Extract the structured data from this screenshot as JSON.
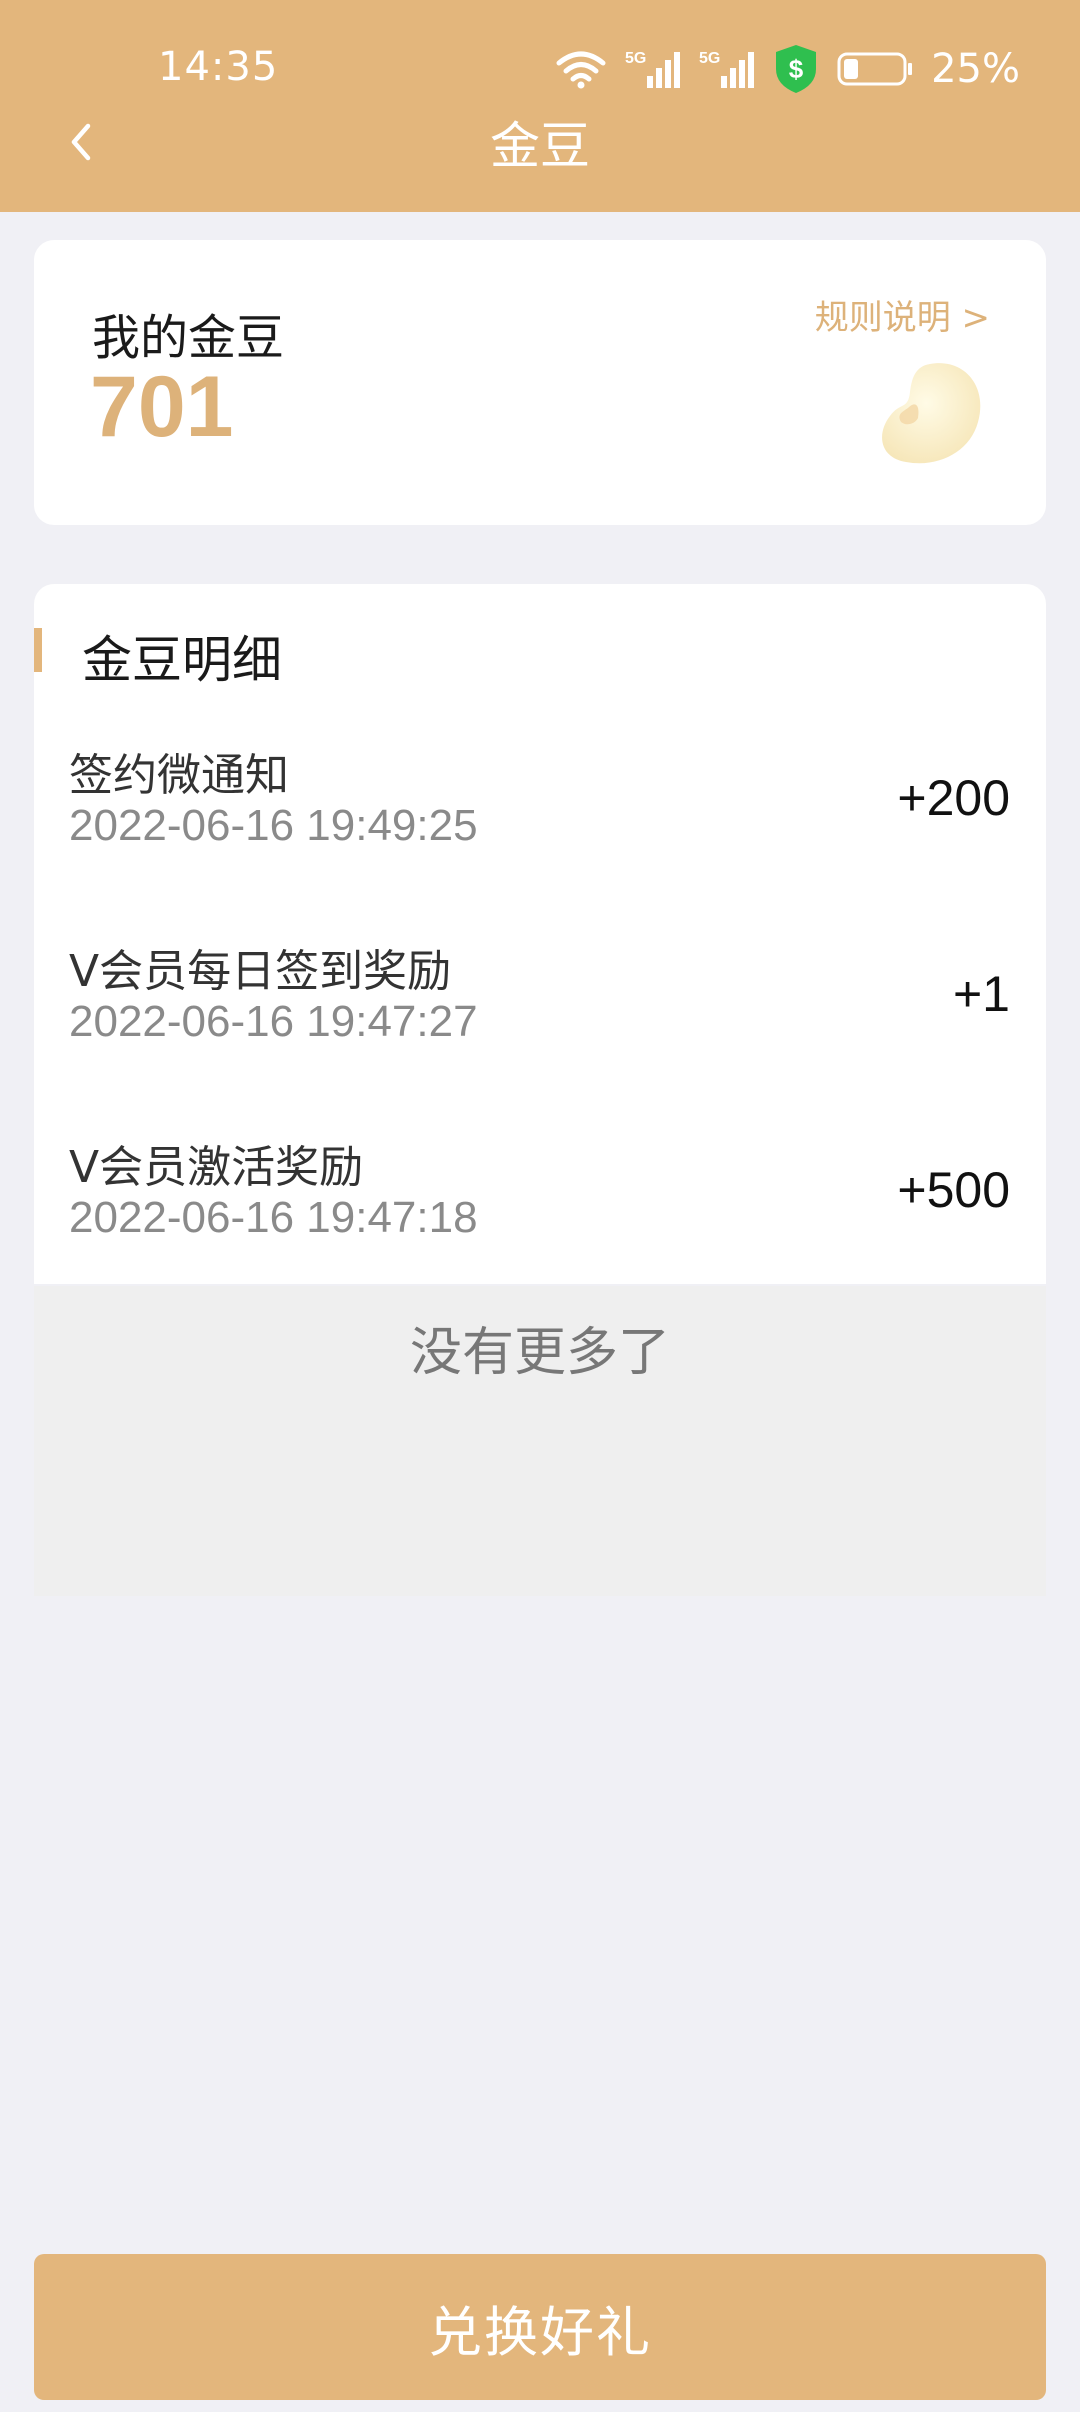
{
  "status_bar": {
    "time": "14:35",
    "battery": "25%",
    "icons": [
      "wifi-icon",
      "signal-5g-icon",
      "signal-5g-icon",
      "security-shield-icon",
      "battery-icon"
    ]
  },
  "nav": {
    "title": "金豆",
    "back_icon": "chevron-left-icon"
  },
  "balance": {
    "label": "我的金豆",
    "value": "701",
    "rules_link": "规则说明 >"
  },
  "detail": {
    "title": "金豆明细",
    "rows": [
      {
        "title": "签约微通知",
        "time": "2022-06-16 19:49:25",
        "amount": "+200"
      },
      {
        "title": "V会员每日签到奖励",
        "time": "2022-06-16 19:47:27",
        "amount": "+1"
      },
      {
        "title": "V会员激活奖励",
        "time": "2022-06-16 19:47:18",
        "amount": "+500"
      }
    ],
    "no_more": "没有更多了"
  },
  "footer": {
    "redeem_label": "兑换好礼"
  },
  "colors": {
    "accent": "#e3b67c",
    "accent_text": "#ddb27a",
    "background": "#f0f0f5"
  }
}
